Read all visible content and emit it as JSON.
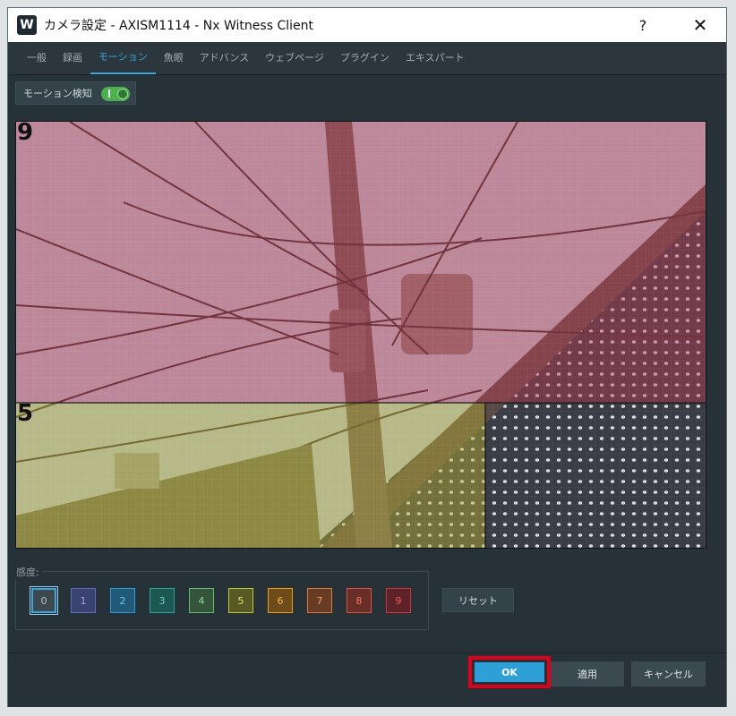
{
  "window": {
    "app_icon_letter": "W",
    "title": "カメラ設定 - AXISM1114 - Nx Witness Client",
    "help": "?",
    "close": "✕"
  },
  "tabs": [
    {
      "label": "一般",
      "active": false
    },
    {
      "label": "録画",
      "active": false
    },
    {
      "label": "モーション",
      "active": true
    },
    {
      "label": "魚眼",
      "active": false
    },
    {
      "label": "アドバンス",
      "active": false
    },
    {
      "label": "ウェブページ",
      "active": false
    },
    {
      "label": "プラグイン",
      "active": false
    },
    {
      "label": "エキスパート",
      "active": false
    }
  ],
  "motion": {
    "toggle_label": "モーション検知",
    "enabled": true
  },
  "camera_view": {
    "region_labels": [
      "9",
      "5"
    ]
  },
  "sensitivity": {
    "title": "感度:",
    "levels": [
      {
        "label": "0",
        "color": "#8a969c",
        "selected": true
      },
      {
        "label": "1",
        "color": "#5c6bc0",
        "selected": false
      },
      {
        "label": "2",
        "color": "#2e9bd6",
        "selected": false
      },
      {
        "label": "3",
        "color": "#26a69a",
        "selected": false
      },
      {
        "label": "4",
        "color": "#66bb6a",
        "selected": false
      },
      {
        "label": "5",
        "color": "#c0ca33",
        "selected": false
      },
      {
        "label": "6",
        "color": "#f39c12",
        "selected": false
      },
      {
        "label": "7",
        "color": "#e07a30",
        "selected": false
      },
      {
        "label": "8",
        "color": "#e0503a",
        "selected": false
      },
      {
        "label": "9",
        "color": "#d0343a",
        "selected": false
      }
    ],
    "reset_label": "リセット"
  },
  "footer": {
    "ok_label": "OK",
    "apply_label": "適用",
    "cancel_label": "キャンセル"
  },
  "colors": {
    "accent": "#3aa7df",
    "highlight_outline": "#e0001a",
    "region_9": "#c86a78",
    "region_5": "#b8b050"
  }
}
